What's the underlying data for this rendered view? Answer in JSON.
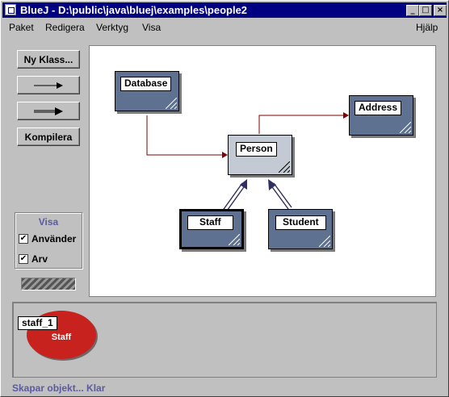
{
  "window": {
    "title": "BlueJ - D:\\public\\java\\bluej\\examples\\people2",
    "controls": {
      "minimize": "_",
      "maximize": "□",
      "close": "×"
    }
  },
  "menubar": {
    "items": [
      "Paket",
      "Redigera",
      "Verktyg",
      "Visa"
    ],
    "help": "Hjälp"
  },
  "toolbar": {
    "new_class": "Ny Klass...",
    "uses_arrow_icon": "arrow-right-icon",
    "inherit_arrow_icon": "double-arrow-right-icon",
    "compile": "Kompilera"
  },
  "view_panel": {
    "title": "Visa",
    "options": [
      {
        "label": "Använder",
        "checked": true,
        "mark": "✔"
      },
      {
        "label": "Arv",
        "checked": true,
        "mark": "✔"
      }
    ]
  },
  "diagram": {
    "classes": [
      "Database",
      "Person",
      "Address",
      "Staff",
      "Student"
    ],
    "colors": {
      "class": "#5e7191",
      "abstract": "#c3cad3",
      "uses_arrow": "#800000",
      "inherit_arrow": "#303060"
    }
  },
  "object_bench": {
    "objects": [
      {
        "name": "staff_1",
        "class": "Staff"
      }
    ]
  },
  "status": "Skapar objekt... Klar"
}
